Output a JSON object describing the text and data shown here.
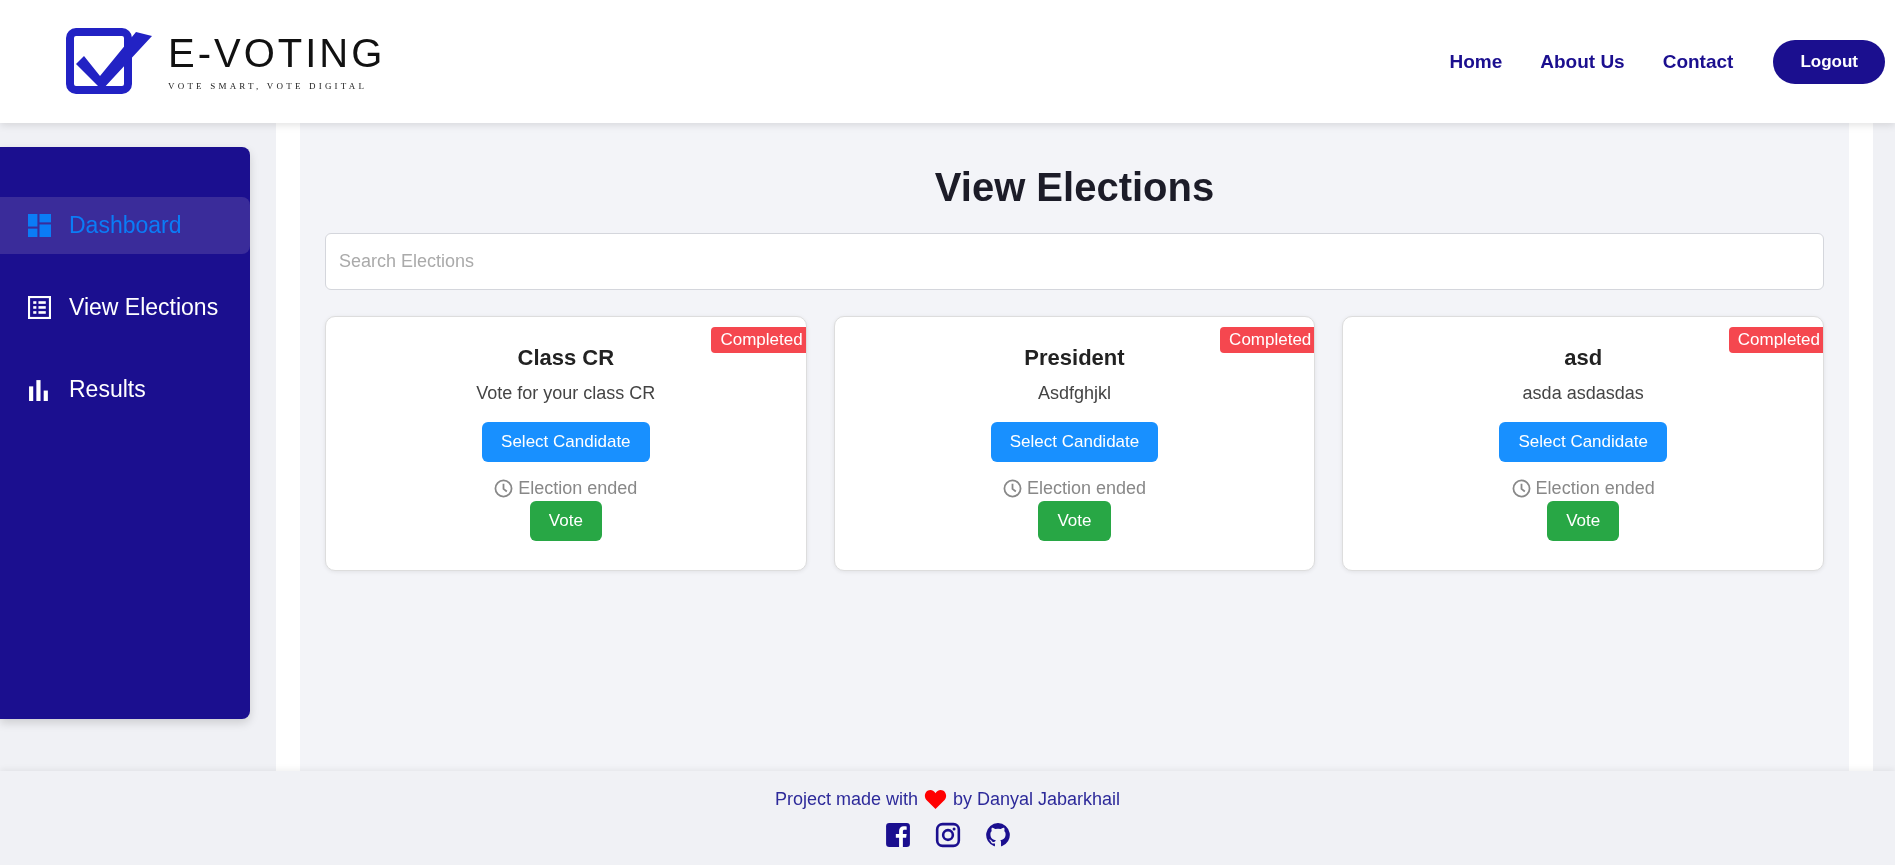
{
  "header": {
    "logo": {
      "title": "E-VOTING",
      "tagline": "VOTE SMART, VOTE DIGITAL"
    },
    "nav": [
      {
        "label": "Home"
      },
      {
        "label": "About Us"
      },
      {
        "label": "Contact"
      }
    ],
    "logout": "Logout"
  },
  "sidebar": {
    "items": [
      {
        "label": "Dashboard",
        "kind": "dashboard",
        "selected": true
      },
      {
        "label": "View Elections",
        "kind": "list",
        "selected": false
      },
      {
        "label": "Results",
        "kind": "bars",
        "selected": false
      }
    ]
  },
  "main": {
    "title": "View Elections",
    "search": {
      "placeholder": "Search Elections"
    },
    "elections": [
      {
        "title": "Class CR",
        "description": "Vote for your class CR",
        "status": "Completed",
        "select_button": "Select Candidate",
        "time_note": "Election ended",
        "vote_button": "Vote"
      },
      {
        "title": "President",
        "description": "Asdfghjkl",
        "status": "Completed",
        "select_button": "Select Candidate",
        "time_note": "Election ended",
        "vote_button": "Vote"
      },
      {
        "title": "asd",
        "description": "asda asdasdas",
        "status": "Completed",
        "select_button": "Select Candidate",
        "time_note": "Election ended",
        "vote_button": "Vote"
      }
    ]
  },
  "footer": {
    "credit_before": "Project made with",
    "credit_after": "by Danyal Jabarkhail",
    "social": [
      {
        "kind": "facebook"
      },
      {
        "kind": "instagram"
      },
      {
        "kind": "github"
      }
    ]
  }
}
